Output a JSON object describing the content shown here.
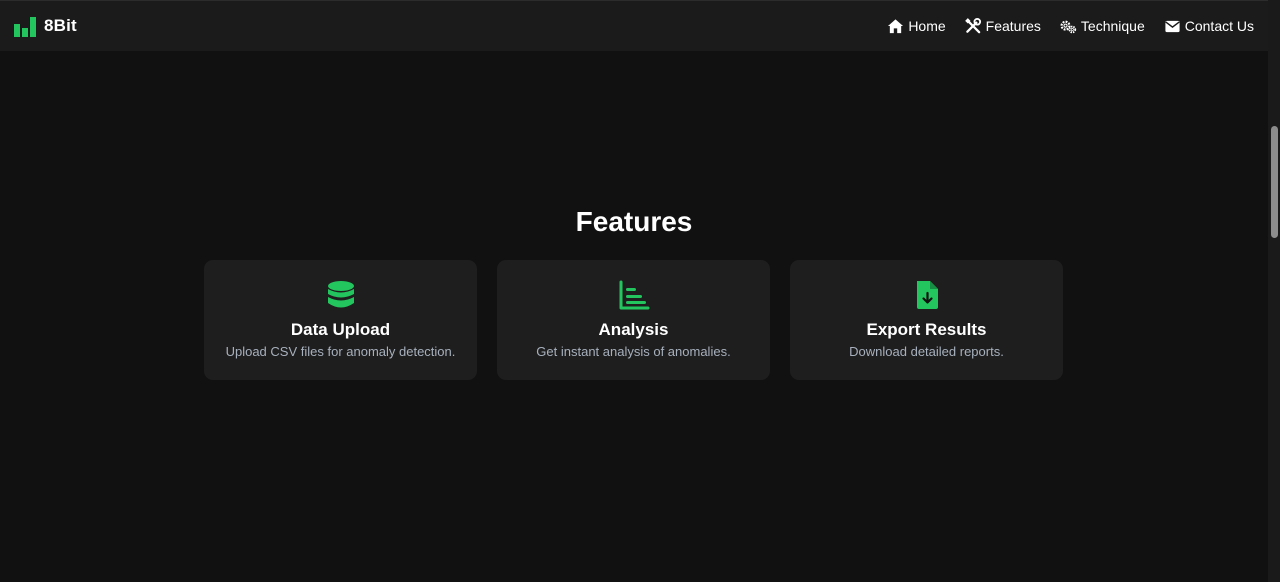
{
  "brand": {
    "name": "8Bit",
    "icon": "bar-chart-icon"
  },
  "nav": {
    "links": [
      {
        "label": "Home",
        "icon": "home-icon"
      },
      {
        "label": "Features",
        "icon": "tools-icon"
      },
      {
        "label": "Technique",
        "icon": "gears-icon"
      },
      {
        "label": "Contact Us",
        "icon": "envelope-icon"
      }
    ]
  },
  "features": {
    "title": "Features",
    "cards": [
      {
        "title": "Data Upload",
        "description": "Upload CSV files for anomaly detection.",
        "icon": "database-icon"
      },
      {
        "title": "Analysis",
        "description": "Get instant analysis of anomalies.",
        "icon": "chart-bars-icon"
      },
      {
        "title": "Export Results",
        "description": "Download detailed reports.",
        "icon": "file-download-icon"
      }
    ]
  },
  "colors": {
    "accent": "#22c55e",
    "background": "#111111",
    "navbar": "#1b1b1b",
    "card": "#1e1e1e",
    "muted_text": "#a7b0bd"
  }
}
